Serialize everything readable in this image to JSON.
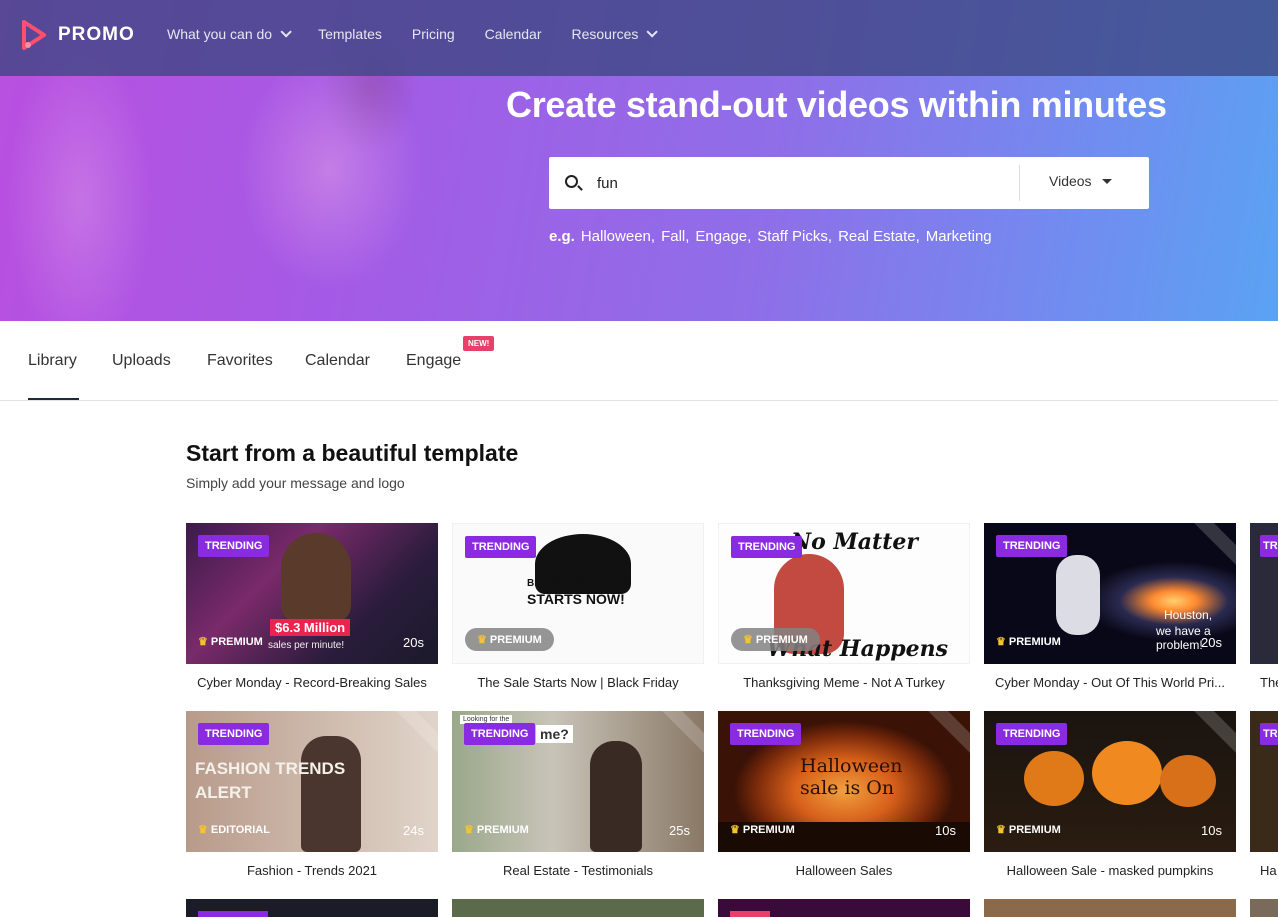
{
  "header": {
    "brand": "PROMO",
    "nav": [
      {
        "label": "What you can do",
        "has_dropdown": true
      },
      {
        "label": "Templates",
        "has_dropdown": false
      },
      {
        "label": "Pricing",
        "has_dropdown": false
      },
      {
        "label": "Calendar",
        "has_dropdown": false
      },
      {
        "label": "Resources",
        "has_dropdown": true
      }
    ]
  },
  "hero": {
    "title": "Create stand-out videos within minutes",
    "search_value": "fun",
    "type_select": "Videos",
    "eg_label": "e.g.",
    "examples": [
      "Halloween,",
      "Fall,",
      "Engage,",
      "Staff Picks,",
      "Real Estate,",
      "Marketing"
    ]
  },
  "tabs": {
    "items": [
      "Library",
      "Uploads",
      "Favorites",
      "Calendar",
      "Engage"
    ],
    "active": "Library",
    "new_badge": "NEW!"
  },
  "section": {
    "title": "Start from a beautiful template",
    "subtitle": "Simply add your message and logo"
  },
  "cards": [
    {
      "caption": "Cyber Monday - Record-Breaking Sales",
      "trending": "TRENDING",
      "tier": "PREMIUM",
      "duration": "20s",
      "overlay_top": "$6.3 Million",
      "overlay_sub": "sales per minute!"
    },
    {
      "caption": "The Sale Starts Now | Black Friday",
      "trending": "TRENDING",
      "tier": "PREMIUM",
      "duration": "",
      "overlay_top": "BLACK FRIDAY SALE",
      "overlay_sub": "STARTS NOW!"
    },
    {
      "caption": "Thanksgiving Meme - Not A Turkey",
      "trending": "TRENDING",
      "tier": "PREMIUM",
      "duration": "",
      "overlay_top": "No Matter",
      "overlay_sub": "What Happens"
    },
    {
      "caption": "Cyber Monday - Out Of This World Pri...",
      "trending": "TRENDING",
      "tier": "PREMIUM",
      "duration": "20s",
      "overlay_top": "Houston,",
      "overlay_sub": "we have a problem!"
    },
    {
      "caption": "Fashion - Trends 2021",
      "trending": "TRENDING",
      "tier": "EDITORIAL",
      "duration": "24s",
      "overlay_top": "FASHION TRENDS",
      "overlay_sub": "ALERT"
    },
    {
      "caption": "Real Estate - Testimonials",
      "trending": "TRENDING",
      "tier": "PREMIUM",
      "duration": "25s",
      "overlay_top": "Looking for the",
      "overlay_sub": "me?"
    },
    {
      "caption": "Halloween Sales",
      "trending": "TRENDING",
      "tier": "PREMIUM",
      "duration": "10s",
      "overlay_top": "Halloween",
      "overlay_sub": "sale is On"
    },
    {
      "caption": "Halloween Sale - masked pumpkins",
      "trending": "TRENDING",
      "tier": "PREMIUM",
      "duration": "10s",
      "overlay_top": "",
      "overlay_sub": ""
    }
  ],
  "partial_col": {
    "badge": "TR",
    "caption_r1": "The",
    "caption_r2": "Ha"
  },
  "colors": {
    "accent_purple": "#8a2be2",
    "new_badge": "#e7416b",
    "hero_left": "#b94fe0",
    "hero_right": "#5aa3f3"
  }
}
